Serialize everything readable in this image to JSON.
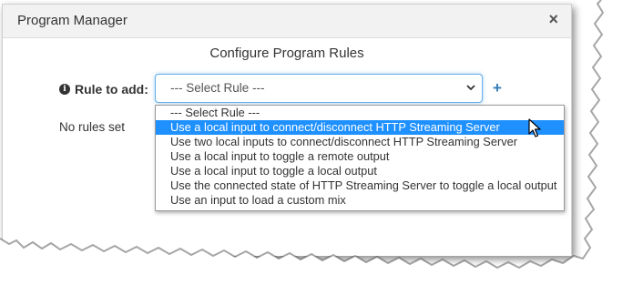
{
  "dialog": {
    "title": "Program Manager",
    "close_glyph": "×",
    "section_title": "Configure Program Rules"
  },
  "rule_form": {
    "label": "Rule to add:",
    "info_glyph": "i",
    "selected_value": "--- Select Rule ---",
    "add_glyph": "+",
    "empty_message": "No rules set"
  },
  "dropdown": {
    "options": [
      "--- Select Rule ---",
      "Use a local input to connect/disconnect HTTP Streaming Server",
      "Use two local inputs to connect/disconnect HTTP Streaming Server",
      "Use a local input to toggle a remote output",
      "Use a local input to toggle a local output",
      "Use the connected state of HTTP Streaming Server to toggle a local output",
      "Use an input to load a custom mix"
    ],
    "highlighted_index": 1
  },
  "colors": {
    "highlight": "#1e90ff",
    "accent": "#337ab7",
    "header_bg": "#f2f2f2"
  },
  "icons": {
    "close": "close-icon",
    "info": "info-icon",
    "chevron": "chevron-down-icon",
    "add": "plus-icon",
    "cursor": "mouse-pointer-icon"
  }
}
